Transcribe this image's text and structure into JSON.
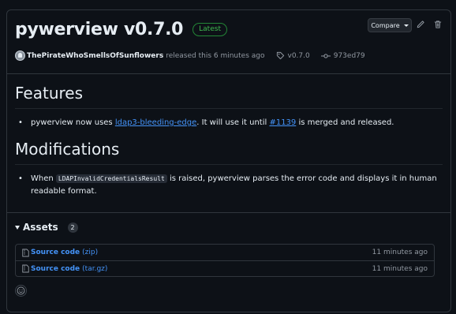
{
  "release": {
    "title": "pywerview v0.7.0",
    "latest_badge": "Latest",
    "compare_label": "Compare",
    "author": "ThePirateWhoSmellsOfSunflowers",
    "released_text": "released this 6 minutes ago",
    "tag": "v0.7.0",
    "commit": "973ed79"
  },
  "body": {
    "features_heading": "Features",
    "features_item": {
      "pre": "pywerview now uses ",
      "link1": "ldap3-bleeding-edge",
      "mid": ". It will use it until ",
      "link2": "#1139",
      "post": " is merged and released."
    },
    "modifications_heading": "Modifications",
    "modifications_item": {
      "pre": "When ",
      "code": "LDAPInvalidCredentialsResult",
      "post": " is raised, pywerview parses the error code and displays it in human",
      "post2": "readable format."
    }
  },
  "assets": {
    "heading": "Assets",
    "count": "2",
    "items": [
      {
        "name": "Source code",
        "type": "(zip)",
        "time": "11 minutes ago"
      },
      {
        "name": "Source code",
        "type": "(tar.gz)",
        "time": "11 minutes ago"
      }
    ]
  },
  "icons": [
    "avatar",
    "tag-icon",
    "commit-icon",
    "pencil-icon",
    "trash-icon",
    "file-zip-icon",
    "smiley-icon",
    "caret-down-icon"
  ],
  "colors": {
    "accent_link": "#4493f8",
    "latest_green": "#3fb950",
    "bg": "#0d1117",
    "border": "#30363d"
  }
}
